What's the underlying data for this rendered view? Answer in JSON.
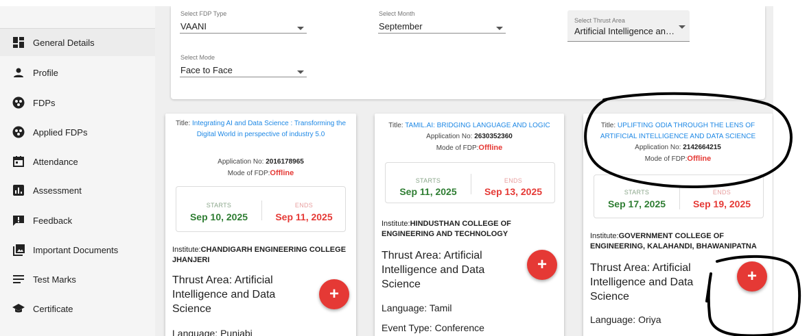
{
  "sidebar": {
    "items": [
      {
        "label": "General Details",
        "icon": "dashboard-icon",
        "active": true
      },
      {
        "label": "Profile",
        "icon": "person-icon"
      },
      {
        "label": "FDPs",
        "icon": "group-icon"
      },
      {
        "label": "Applied FDPs",
        "icon": "group-icon"
      },
      {
        "label": "Attendance",
        "icon": "calendar-icon"
      },
      {
        "label": "Assessment",
        "icon": "bar-chart-icon"
      },
      {
        "label": "Feedback",
        "icon": "feedback-icon"
      },
      {
        "label": "Important Documents",
        "icon": "photo-library-icon"
      },
      {
        "label": "Test Marks",
        "icon": "list-icon"
      },
      {
        "label": "Certificate",
        "icon": "graduation-cap-icon"
      }
    ]
  },
  "filters": {
    "fdp_type": {
      "label": "Select FDP Type",
      "value": "VAANI"
    },
    "month": {
      "label": "Select Month",
      "value": "September"
    },
    "thrust_area": {
      "label": "Select Thrust Area",
      "value": "Artificial Intelligence an…"
    },
    "mode": {
      "label": "Select Mode",
      "value": "Face to Face"
    }
  },
  "common": {
    "title_prefix": "Title: ",
    "app_prefix": "Application No: ",
    "mode_prefix": "Mode of FDP:",
    "starts_label": "STARTS",
    "ends_label": "ENDS",
    "institute_prefix": "Institute:",
    "thrust_prefix": "Thrust Area: ",
    "language_prefix": "Language: ",
    "event_prefix": "Event Type: ",
    "add_symbol": "+"
  },
  "cards": [
    {
      "title": "Integrating AI and Data Science : Transforming the Digital World in perspective of industry 5.0",
      "application_no": "2016178965",
      "mode": "Offline",
      "starts": "Sep 10, 2025",
      "ends": "Sep 11, 2025",
      "institute": "CHANDIGARH ENGINEERING COLLEGE JHANJERI",
      "thrust_area": "Artificial Intelligence and Data Science",
      "language": "Punjabi"
    },
    {
      "title": "TAMIL.AI: BRIDGING LANGUAGE AND LOGIC",
      "application_no": "2630352360",
      "mode": "Offline",
      "starts": "Sep 11, 2025",
      "ends": "Sep 13, 2025",
      "institute": "HINDUSTHAN COLLEGE OF ENGINEERING AND TECHNOLOGY",
      "thrust_area": "Artificial Intelligence and Data Science",
      "language": "Tamil",
      "event_type": "Conference"
    },
    {
      "title": "UPLIFTING ODIA THROUGH THE LENS OF ARTIFICIAL INTELLIGENCE AND DATA SCIENCE",
      "application_no": "2142664215",
      "mode": "Offline",
      "starts": "Sep 17, 2025",
      "ends": "Sep 19, 2025",
      "institute": "GOVERNMENT COLLEGE OF ENGINEERING, KALAHANDI, BHAWANIPATNA",
      "thrust_area": "Artificial Intelligence and Data Science",
      "language": "Oriya"
    }
  ],
  "colors": {
    "link": "#1e88e5",
    "offline": "#e53935",
    "start_date": "#2e7d32",
    "end_date": "#e53935",
    "fab": "#e53935",
    "sidebar_bg": "#f5f5f5",
    "main_bg": "#efefef"
  }
}
